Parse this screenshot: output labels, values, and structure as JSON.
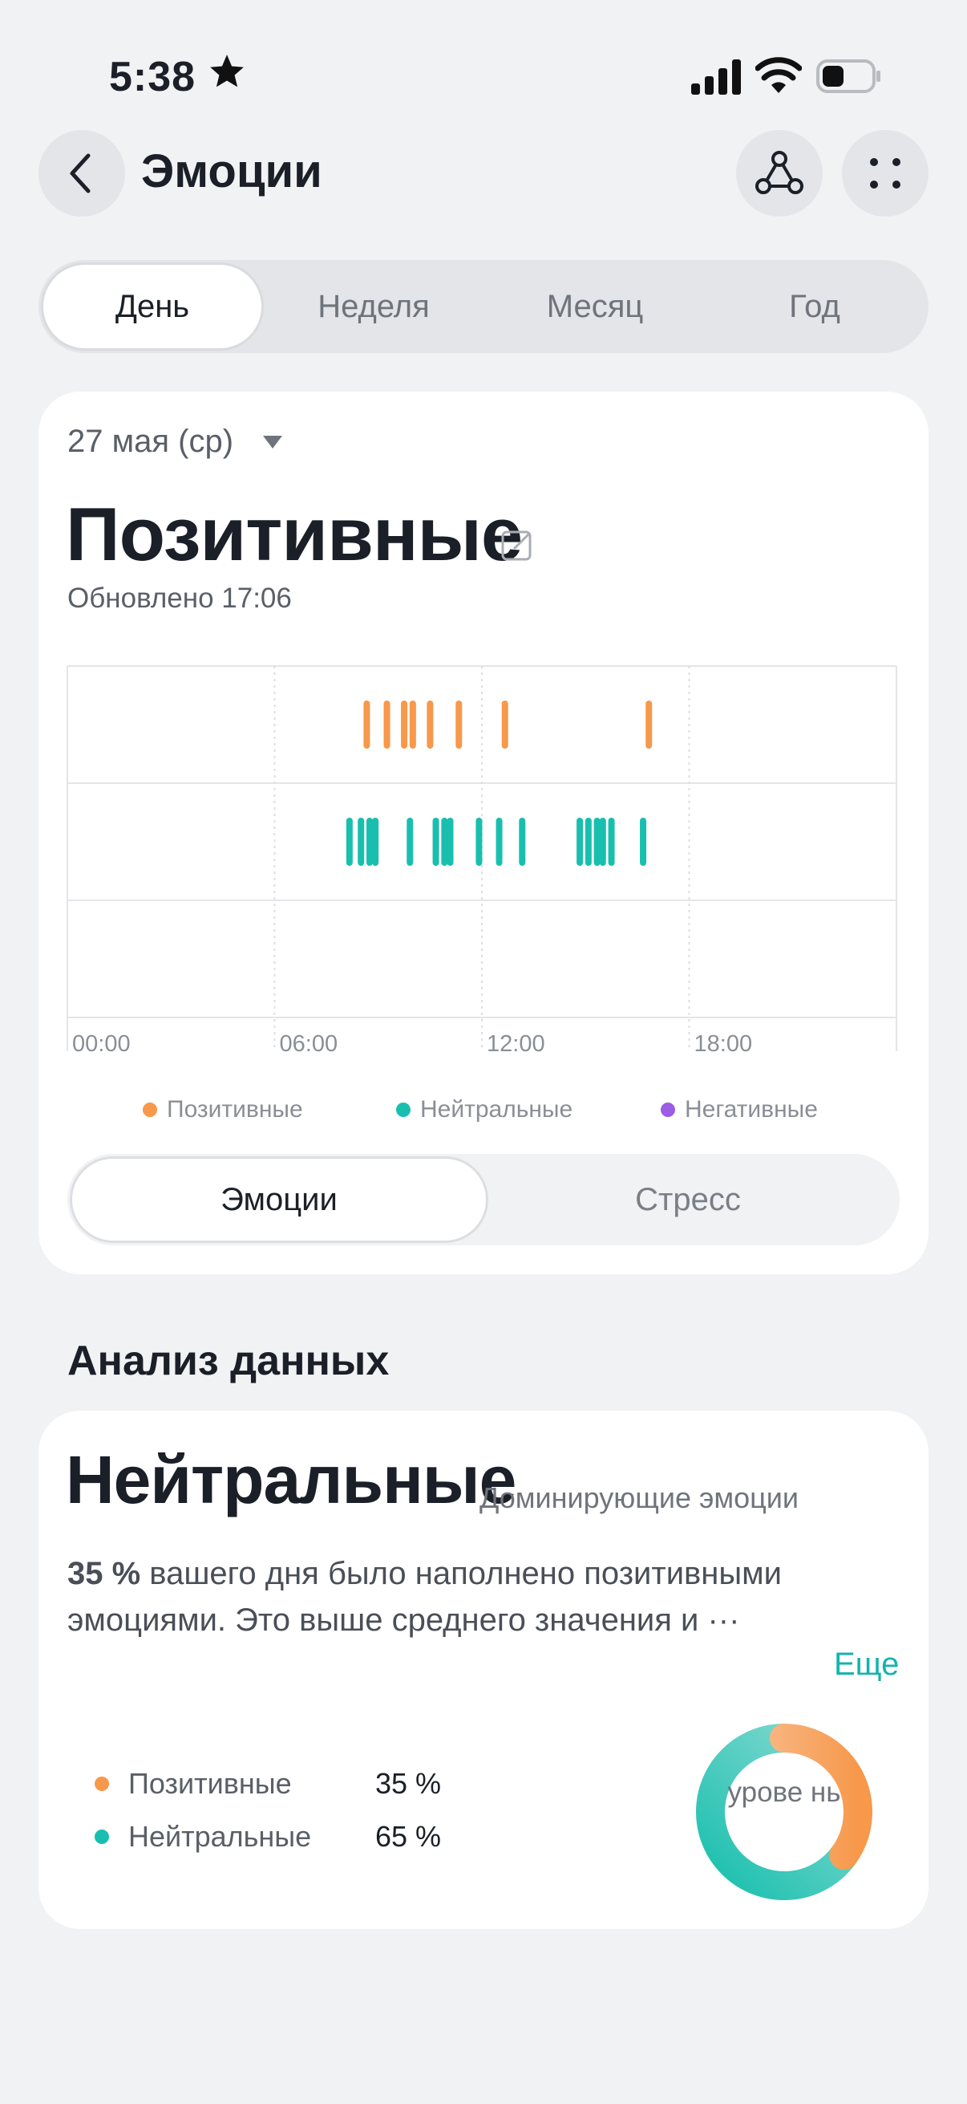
{
  "status_bar": {
    "time": "5:38"
  },
  "header": {
    "title": "Эмоции"
  },
  "period_tabs": [
    {
      "label": "День",
      "active": true
    },
    {
      "label": "Неделя",
      "active": false
    },
    {
      "label": "Месяц",
      "active": false
    },
    {
      "label": "Год",
      "active": false
    }
  ],
  "summary": {
    "date": "27 мая (ср)",
    "status": "Позитивные",
    "updated": "Обновлено 17:06"
  },
  "chart_data": {
    "type": "scatter",
    "x_ticks": [
      "00:00",
      "06:00",
      "12:00",
      "18:00"
    ],
    "xlim": [
      "00:00",
      "24:00"
    ],
    "grid": true,
    "legend_position": "bottom",
    "series": [
      {
        "name": "Позитивные",
        "color": "#f7984b",
        "row": 0,
        "times": [
          "08:40",
          "09:15",
          "09:45",
          "10:00",
          "10:30",
          "11:20",
          "12:40",
          "16:50"
        ]
      },
      {
        "name": "Нейтральные",
        "color": "#19bfae",
        "row": 1,
        "times": [
          "08:10",
          "08:30",
          "08:45",
          "08:55",
          "09:55",
          "10:40",
          "10:55",
          "11:05",
          "11:55",
          "12:30",
          "13:10",
          "14:50",
          "15:05",
          "15:20",
          "15:30",
          "15:45",
          "16:40"
        ]
      },
      {
        "name": "Негативные",
        "color": "#9b5de5",
        "row": 2,
        "times": []
      }
    ]
  },
  "toggle": [
    {
      "label": "Эмоции",
      "active": true
    },
    {
      "label": "Стресс",
      "active": false
    }
  ],
  "analysis": {
    "section_title": "Анализ данных",
    "dominant": "Нейтральные",
    "dominant_caption": "Доминирующие эмоции",
    "desc_strong": "35 %",
    "desc_text": " вашего дня было наполнено позитивными эмоциями. Это выше среднего значения и ···",
    "more": "Еще",
    "stats": [
      {
        "label": "Позитивные",
        "value": "35 %",
        "percent": 35,
        "color": "#f7984b"
      },
      {
        "label": "Нейтральные",
        "value": "65 %",
        "percent": 65,
        "color": "#19bfae"
      }
    ],
    "donut_label": "урове нь"
  }
}
